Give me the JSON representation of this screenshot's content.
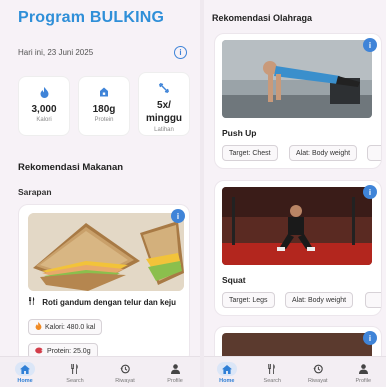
{
  "left": {
    "title": "Program BULKING",
    "date": "Hari ini, 23 Juni 2025",
    "stats": [
      {
        "icon": "flame-icon",
        "value": "3,000",
        "label": "Kalori"
      },
      {
        "icon": "protein-icon",
        "value": "180g",
        "label": "Protein"
      },
      {
        "icon": "dumbbell-icon",
        "value": "5x/ minggu",
        "label": "Latihan"
      }
    ],
    "section_meal": "Rekomendasi Makanan",
    "meal_time": "Sarapan",
    "food": {
      "name": "Roti gandum dengan telur dan keju",
      "calories": "Kalori: 480.0 kal",
      "protein": "Protein: 25.0g"
    }
  },
  "right": {
    "title": "Rekomendasi Olahraga",
    "exercises": [
      {
        "name": "Push Up",
        "target": "Target: Chest",
        "tool": "Alat: Body weight"
      },
      {
        "name": "Squat",
        "target": "Target: Legs",
        "tool": "Alat: Body weight"
      }
    ]
  },
  "nav": [
    {
      "label": "Home",
      "icon": "home-icon"
    },
    {
      "label": "Search",
      "icon": "fork-knife-icon"
    },
    {
      "label": "Riwayat",
      "icon": "history-icon"
    },
    {
      "label": "Profile",
      "icon": "person-icon"
    }
  ],
  "colors": {
    "accent": "#2f8fd8",
    "info": "#3f84d8",
    "nav_active_bg": "#dbe6f7"
  }
}
